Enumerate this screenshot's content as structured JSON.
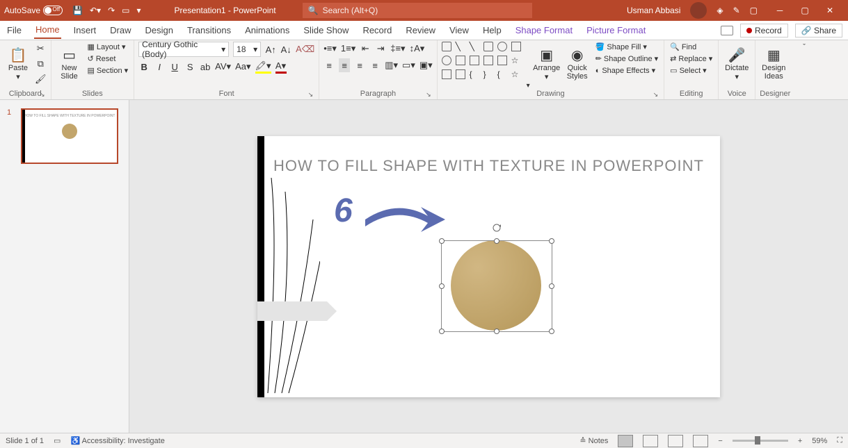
{
  "titlebar": {
    "autosave_label": "AutoSave",
    "autosave_state": "Off",
    "title": "Presentation1 - PowerPoint",
    "search_placeholder": "Search (Alt+Q)",
    "user_name": "Usman Abbasi"
  },
  "tabs": {
    "file": "File",
    "home": "Home",
    "insert": "Insert",
    "draw": "Draw",
    "design": "Design",
    "transitions": "Transitions",
    "animations": "Animations",
    "slideshow": "Slide Show",
    "record": "Record",
    "review": "Review",
    "view": "View",
    "help": "Help",
    "shape_format": "Shape Format",
    "picture_format": "Picture Format",
    "record_btn": "Record",
    "share_btn": "Share"
  },
  "ribbon": {
    "clipboard": {
      "label": "Clipboard",
      "paste": "Paste"
    },
    "slides": {
      "label": "Slides",
      "new_slide": "New\nSlide",
      "layout": "Layout",
      "reset": "Reset",
      "section": "Section"
    },
    "font": {
      "label": "Font",
      "name": "Century Gothic (Body)",
      "size": "18"
    },
    "paragraph": {
      "label": "Paragraph"
    },
    "drawing": {
      "label": "Drawing",
      "arrange": "Arrange",
      "quick_styles": "Quick\nStyles",
      "shape_fill": "Shape Fill",
      "shape_outline": "Shape Outline",
      "shape_effects": "Shape Effects"
    },
    "editing": {
      "label": "Editing",
      "find": "Find",
      "replace": "Replace",
      "select": "Select"
    },
    "voice": {
      "label": "Voice",
      "dictate": "Dictate"
    },
    "designer": {
      "label": "Designer",
      "design_ideas": "Design\nIdeas"
    }
  },
  "slide": {
    "number": "1",
    "title": "HOW TO FILL SHAPE WITH TEXTURE IN POWERPOINT",
    "annotation_number": "6"
  },
  "statusbar": {
    "slide_info": "Slide 1 of 1",
    "accessibility": "Accessibility: Investigate",
    "notes": "Notes",
    "zoom": "59%"
  }
}
